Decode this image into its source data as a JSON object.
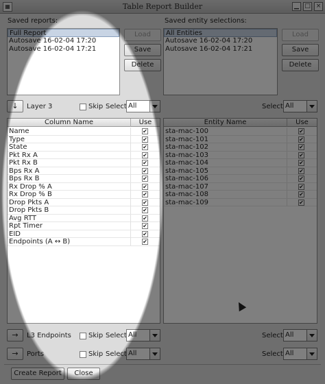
{
  "window": {
    "title": "Table Report Builder",
    "minimize_glyph": "▁",
    "maximize_glyph": "□",
    "close_glyph": "×"
  },
  "saved_reports": {
    "label": "Saved reports:",
    "items": [
      "Full Report",
      "Autosave 16-02-04 17:20",
      "Autosave 16-02-04 17:21"
    ],
    "selected": 0,
    "load_label": "Load",
    "save_label": "Save",
    "delete_label": "Delete"
  },
  "saved_entities": {
    "label": "Saved entity selections:",
    "items": [
      "All Entities",
      "Autosave 16-02-04 17:20",
      "Autosave 16-02-04 17:21"
    ],
    "selected": 0,
    "load_label": "Load",
    "save_label": "Save",
    "delete_label": "Delete"
  },
  "layer3": {
    "arrow": "↓",
    "label": "Layer 3",
    "skip_label": "Skip",
    "select_label": "Select",
    "select_value": "All",
    "right_select_label": "Select",
    "right_select_value": "All"
  },
  "columns_table": {
    "header_name": "Column Name",
    "header_use": "Use",
    "rows": [
      "Name",
      "Type",
      "State",
      "Pkt Rx A",
      "Pkt Rx B",
      "Bps Rx A",
      "Bps Rx B",
      "Rx Drop % A",
      "Rx Drop % B",
      "Drop Pkts A",
      "Drop Pkts B",
      "Avg RTT",
      "Rpt Timer",
      "EID",
      "Endpoints (A ↔ B)"
    ],
    "check_glyph": "✔"
  },
  "entity_table": {
    "header_name": "Entity Name",
    "header_use": "Use",
    "rows": [
      "sta-mac-100",
      "sta-mac-101",
      "sta-mac-102",
      "sta-mac-103",
      "sta-mac-104",
      "sta-mac-105",
      "sta-mac-106",
      "sta-mac-107",
      "sta-mac-108",
      "sta-mac-109"
    ],
    "check_glyph": "✔"
  },
  "l3_endpoints": {
    "arrow": "→",
    "label": "L3 Endpoints",
    "skip_label": "Skip",
    "select_label": "Select",
    "select_value": "All",
    "right_select_label": "Select",
    "right_select_value": "All"
  },
  "ports": {
    "arrow": "→",
    "label": "Ports",
    "skip_label": "Skip",
    "select_label": "Select",
    "select_value": "All",
    "right_select_label": "Select",
    "right_select_value": "All"
  },
  "footer": {
    "create_label": "Create Report",
    "close_label": "Close"
  }
}
